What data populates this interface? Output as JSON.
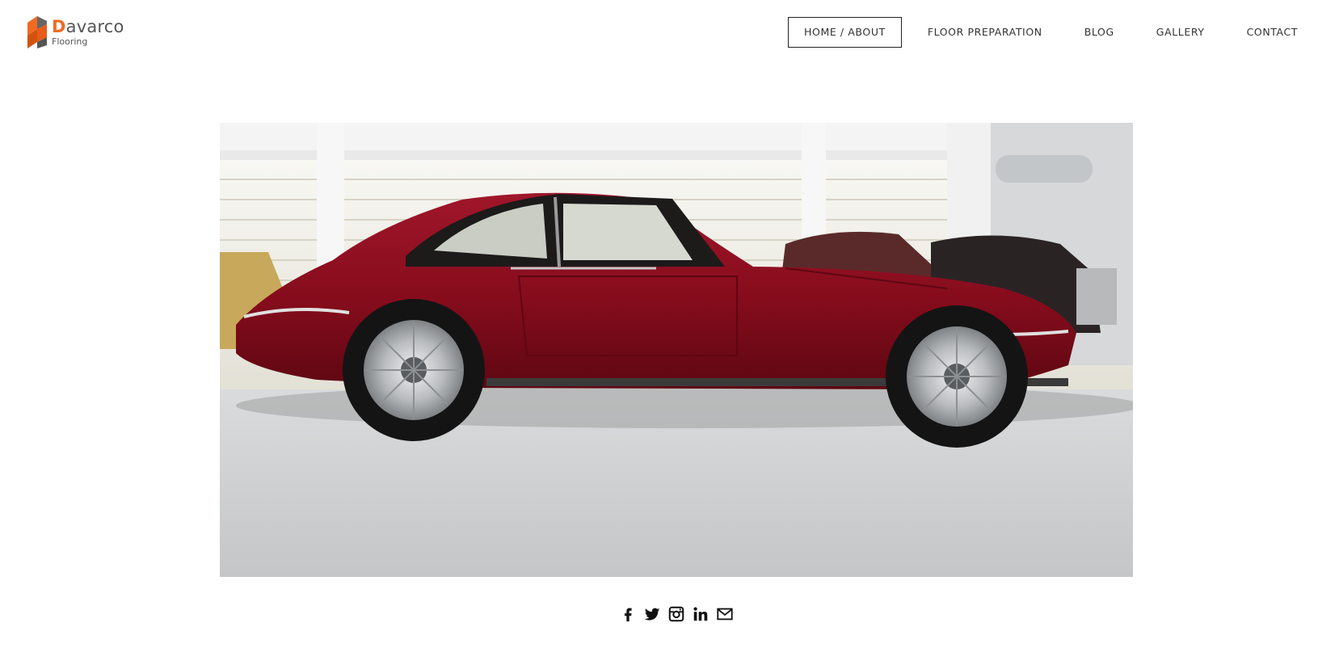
{
  "logo": {
    "first_letter": "D",
    "name_rest": "avarco",
    "subtitle": "Flooring",
    "colors": {
      "orange": "#f26a21",
      "grey": "#555555"
    }
  },
  "nav": {
    "items": [
      {
        "label": "HOME / ABOUT",
        "active": true
      },
      {
        "label": "FLOOR PREPARATION",
        "active": false
      },
      {
        "label": "BLOG",
        "active": false
      },
      {
        "label": "GALLERY",
        "active": false
      },
      {
        "label": "CONTACT",
        "active": false
      }
    ]
  },
  "hero": {
    "subject": "red classic coupe parked in a showroom with a light grey resin floor",
    "colors": {
      "car": "#8e0f1e",
      "floor": "#cfd1d2",
      "wall": "#ecebe4"
    }
  },
  "social": {
    "icons": [
      "facebook-icon",
      "twitter-icon",
      "instagram-icon",
      "linkedin-icon",
      "mail-icon"
    ]
  }
}
